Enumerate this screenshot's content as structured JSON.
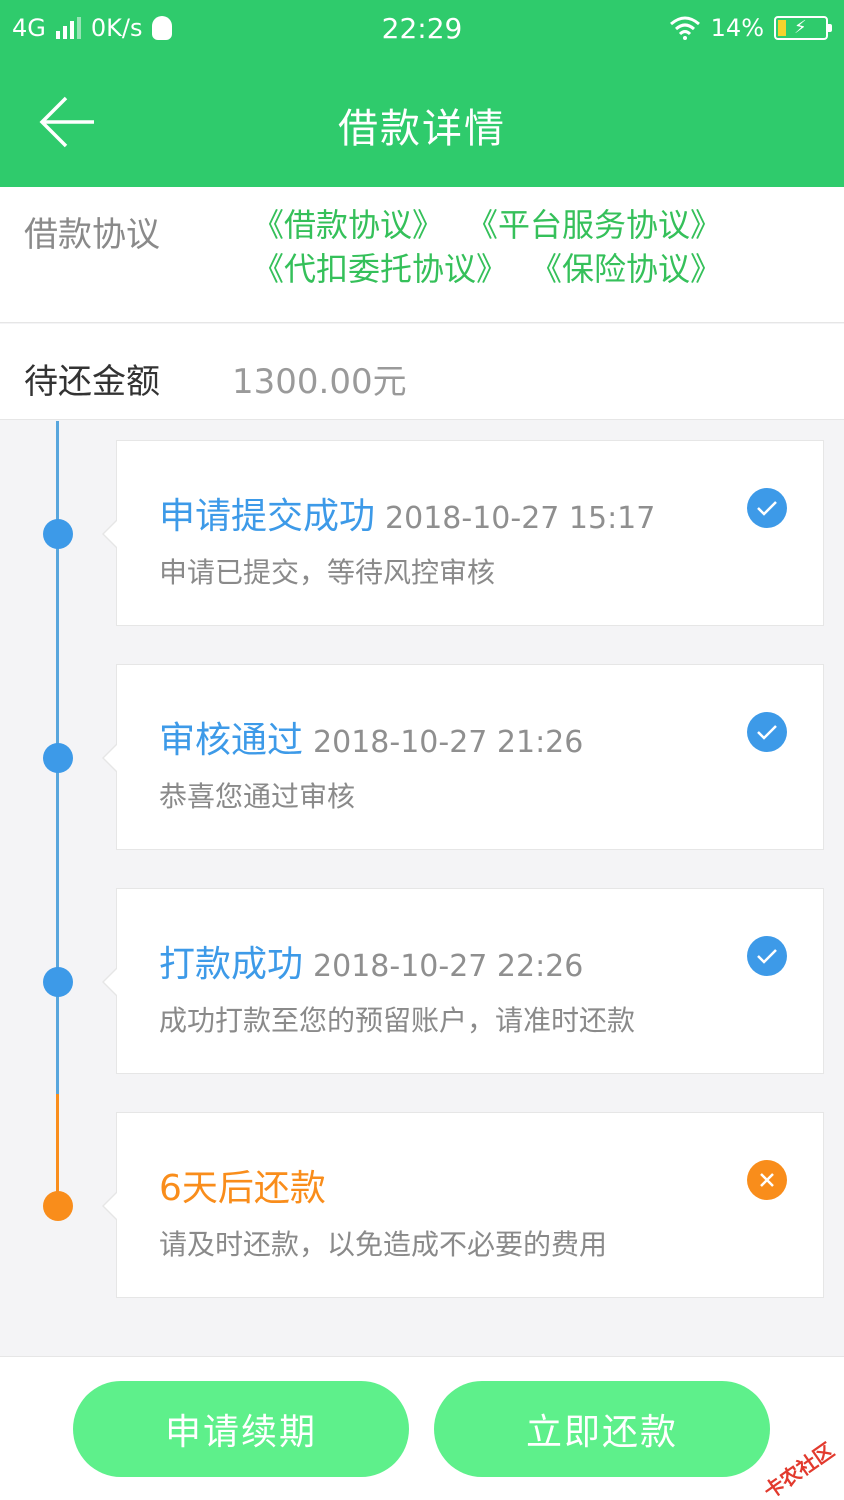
{
  "status_bar": {
    "network": "4G",
    "speed": "0K/s",
    "time": "22:29",
    "battery": "14%"
  },
  "header": {
    "title": "借款详情",
    "back_icon": "arrow-left-icon"
  },
  "agreement": {
    "label": "借款协议",
    "links": [
      "《借款协议》",
      "《平台服务协议》",
      "《代扣委托协议》",
      "《保险协议》"
    ]
  },
  "amount": {
    "label": "待还金额",
    "value": "1300.00元"
  },
  "timeline": [
    {
      "title": "申请提交成功",
      "date": "2018-10-27 15:17",
      "desc": "申请已提交，等待风控审核",
      "state": "done"
    },
    {
      "title": "审核通过",
      "date": "2018-10-27 21:26",
      "desc": "恭喜您通过审核",
      "state": "done"
    },
    {
      "title": "打款成功",
      "date": "2018-10-27 22:26",
      "desc": "成功打款至您的预留账户，请准时还款",
      "state": "done"
    },
    {
      "title": "6天后还款",
      "date": "",
      "desc": "请及时还款，以免造成不必要的费用",
      "state": "pending"
    }
  ],
  "buttons": {
    "renew": "申请续期",
    "pay": "立即还款"
  },
  "watermark": "卡农社区",
  "colors": {
    "header_green": "#2fcb6c",
    "link_green": "#35c05a",
    "done_blue": "#3d9ae8",
    "pending_orange": "#f98d1b",
    "button_green": "#5ef08b"
  }
}
